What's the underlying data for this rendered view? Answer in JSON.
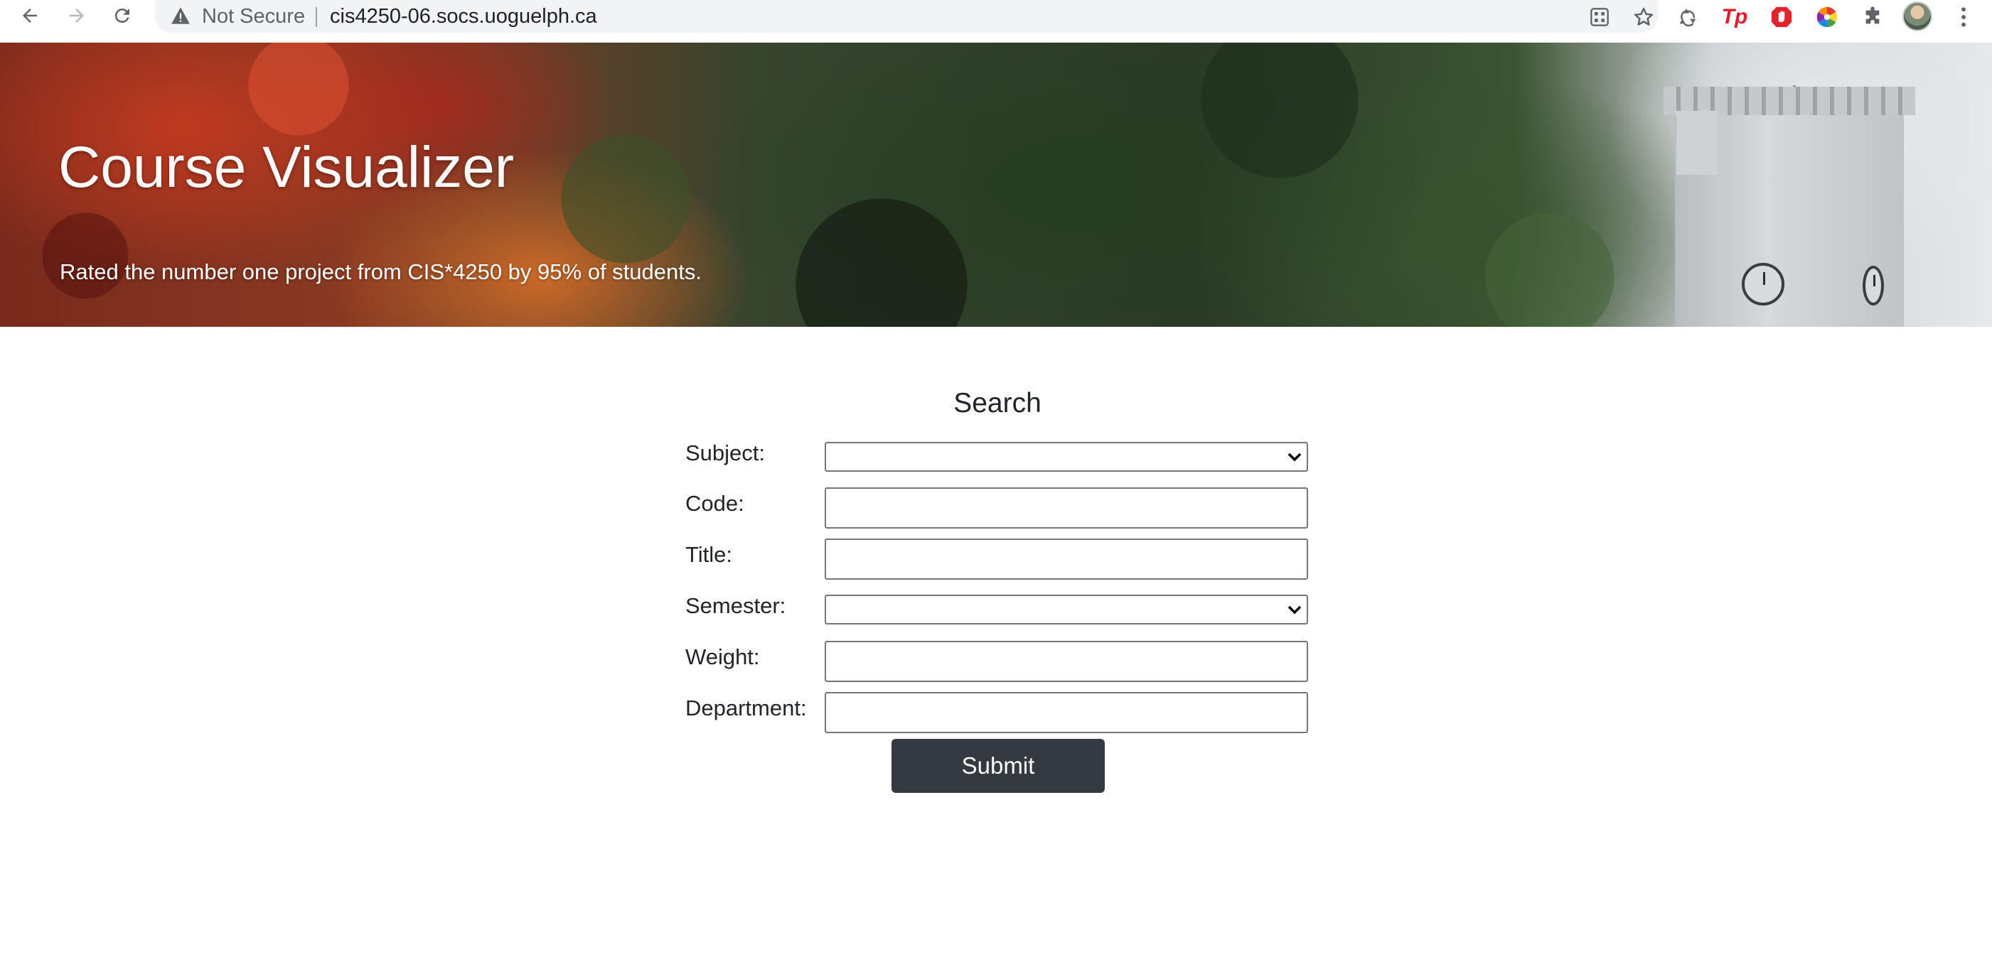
{
  "browser": {
    "security_label": "Not Secure",
    "url": "cis4250-06.socs.uoguelph.ca",
    "icons": {
      "back": "back-arrow-icon",
      "forward": "forward-arrow-icon",
      "reload": "reload-icon",
      "warning": "warning-icon",
      "qr": "qr-code-icon",
      "bookmark": "star-icon",
      "extensions": [
        "recycle-extension-icon",
        "tp-extension-icon",
        "adblock-extension-icon",
        "color-wheel-extension-icon",
        "puzzle-extensions-icon"
      ],
      "profile": "avatar",
      "menu": "kebab-menu-icon"
    },
    "ext_tp_text": "Tp"
  },
  "hero": {
    "title": "Course Visualizer",
    "subtitle": "Rated the number one project from CIS*4250 by 95% of students."
  },
  "search": {
    "heading": "Search",
    "fields": {
      "subject": {
        "label": "Subject:",
        "value": ""
      },
      "code": {
        "label": "Code:",
        "value": ""
      },
      "title": {
        "label": "Title:",
        "value": ""
      },
      "semester": {
        "label": "Semester:",
        "value": ""
      },
      "weight": {
        "label": "Weight:",
        "value": ""
      },
      "department": {
        "label": "Department:",
        "value": ""
      }
    },
    "submit_label": "Submit"
  },
  "colors": {
    "submit_bg": "#343a40",
    "text": "#212529",
    "omnibox_bg": "#f1f3f4"
  }
}
